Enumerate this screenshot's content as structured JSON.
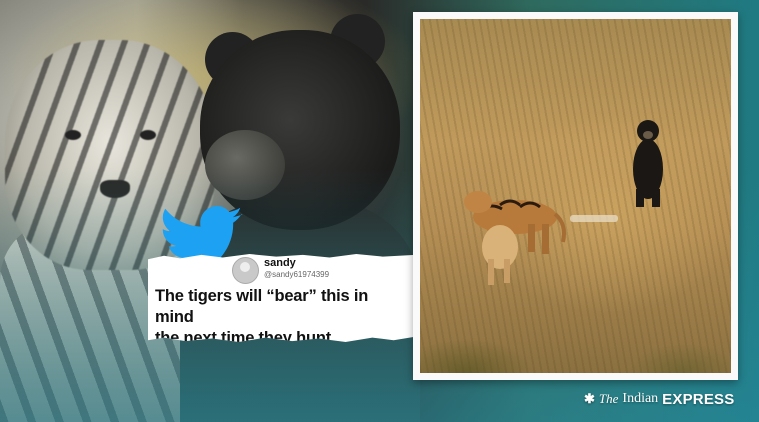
{
  "tweet": {
    "name": "sandy",
    "handle": "@sandy61974399",
    "text_line1": "The tigers will “bear” this in mind",
    "text_line2": "the next time they hunt"
  },
  "watermark": {
    "prefix": "The",
    "name": "Indian",
    "brand": "EXPRESS"
  },
  "colors": {
    "twitter_blue": "#1da1f2",
    "teal_background": "#1f7a82"
  },
  "icons": {
    "bird": "twitter-bird-icon",
    "star": "express-star-icon"
  }
}
